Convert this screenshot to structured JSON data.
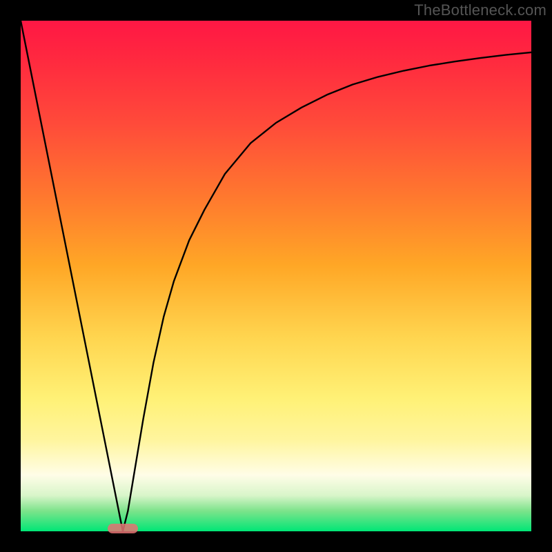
{
  "watermark": "TheBottleneck.com",
  "colors": {
    "frame": "#000000",
    "curve": "#000000",
    "marker": "#e57373",
    "gradient_stops": [
      "#ff1744",
      "#ff2a3f",
      "#ff4a3a",
      "#ff7a2e",
      "#ffa726",
      "#ffd54f",
      "#fff176",
      "#fff59d",
      "#fffde7",
      "#d8f5c9",
      "#7de38b",
      "#00e676"
    ]
  },
  "chart_data": {
    "type": "line",
    "title": "",
    "xlabel": "",
    "ylabel": "",
    "xlim": [
      0,
      100
    ],
    "ylim": [
      0,
      100
    ],
    "series": [
      {
        "name": "bottleneck-curve",
        "x": [
          0,
          2,
          4,
          6,
          8,
          10,
          12,
          14,
          16,
          18,
          19,
          20,
          21,
          22,
          23,
          24,
          26,
          28,
          30,
          33,
          36,
          40,
          45,
          50,
          55,
          60,
          65,
          70,
          75,
          80,
          85,
          90,
          95,
          100
        ],
        "values": [
          100,
          90,
          80,
          70,
          60,
          50,
          40,
          30,
          20,
          10,
          5,
          0,
          4,
          10,
          16,
          22,
          33,
          42,
          49,
          57,
          63,
          70,
          76,
          80,
          83,
          85.5,
          87.5,
          89,
          90.2,
          91.2,
          92,
          92.7,
          93.3,
          93.8
        ]
      }
    ],
    "annotations": [
      {
        "name": "minimum-marker",
        "x": 20,
        "y": 0
      }
    ],
    "grid": false,
    "legend": false
  }
}
